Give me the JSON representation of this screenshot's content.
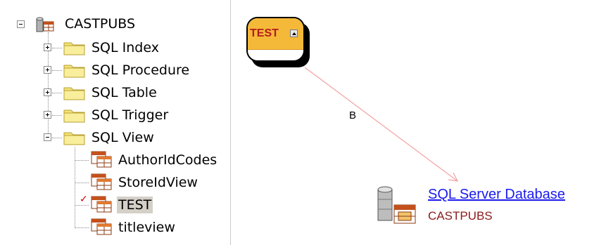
{
  "tree": {
    "root": {
      "label": "CASTPUBS",
      "icon": "database-icon",
      "expanded": true
    },
    "folders": [
      {
        "label": "SQL Index",
        "expanded": false
      },
      {
        "label": "SQL Procedure",
        "expanded": false
      },
      {
        "label": "SQL Table",
        "expanded": false
      },
      {
        "label": "SQL Trigger",
        "expanded": false
      },
      {
        "label": "SQL View",
        "expanded": true
      }
    ],
    "views": [
      {
        "label": "AuthorIdCodes",
        "selected": false,
        "checked": false
      },
      {
        "label": "StoreIdView",
        "selected": false,
        "checked": false
      },
      {
        "label": "TEST",
        "selected": true,
        "checked": true
      },
      {
        "label": "titleview",
        "selected": false,
        "checked": false
      }
    ]
  },
  "diagram": {
    "entity": {
      "title": "TEST",
      "header_color": "#f5b939",
      "title_color": "#b01e1e"
    },
    "link": {
      "label": "B",
      "color": "#f08080"
    },
    "database": {
      "name": "SQL Server Database",
      "subtitle": "CASTPUBS",
      "name_color": "#1a1aee",
      "subtitle_color": "#8b1a1a"
    }
  }
}
